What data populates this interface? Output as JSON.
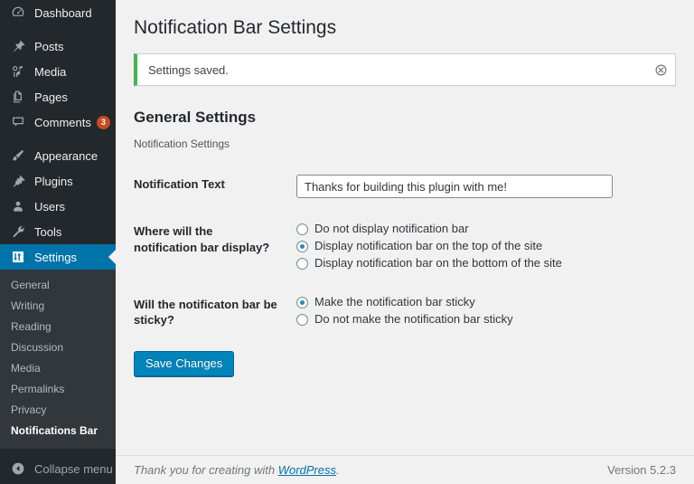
{
  "sidebar": {
    "items": [
      {
        "label": "Dashboard",
        "icon": "dashboard-icon",
        "current": false,
        "badge": null
      },
      {
        "label": "Posts",
        "icon": "pin-icon",
        "current": false,
        "badge": null
      },
      {
        "label": "Media",
        "icon": "media-icon",
        "current": false,
        "badge": null
      },
      {
        "label": "Pages",
        "icon": "pages-icon",
        "current": false,
        "badge": null
      },
      {
        "label": "Comments",
        "icon": "comment-icon",
        "current": false,
        "badge": "3"
      },
      {
        "label": "Appearance",
        "icon": "paintbrush-icon",
        "current": false,
        "badge": null
      },
      {
        "label": "Plugins",
        "icon": "plug-icon",
        "current": false,
        "badge": null
      },
      {
        "label": "Users",
        "icon": "user-icon",
        "current": false,
        "badge": null
      },
      {
        "label": "Tools",
        "icon": "wrench-icon",
        "current": false,
        "badge": null
      },
      {
        "label": "Settings",
        "icon": "sliders-icon",
        "current": true,
        "badge": null
      }
    ],
    "submenu": [
      {
        "label": "General",
        "current": false
      },
      {
        "label": "Writing",
        "current": false
      },
      {
        "label": "Reading",
        "current": false
      },
      {
        "label": "Discussion",
        "current": false
      },
      {
        "label": "Media",
        "current": false
      },
      {
        "label": "Permalinks",
        "current": false
      },
      {
        "label": "Privacy",
        "current": false
      },
      {
        "label": "Notifications Bar",
        "current": true
      }
    ],
    "collapse_label": "Collapse menu",
    "collapse_icon": "chevron-left-circle-icon",
    "colors": {
      "background": "#23282d",
      "submenu_background": "#32373c",
      "current_background": "#0073aa",
      "badge_background": "#ca4a1f"
    }
  },
  "page": {
    "title": "Notification Bar Settings"
  },
  "notice": {
    "message": "Settings saved.",
    "dismiss_icon": "dismiss-circle-icon",
    "accent_color": "#46b450"
  },
  "section": {
    "heading": "General Settings",
    "description": "Notification Settings"
  },
  "fields": {
    "notification_text": {
      "label": "Notification Text",
      "value": "Thanks for building this plugin with me!",
      "placeholder": ""
    },
    "display_position": {
      "label": "Where will the notification bar display?",
      "options": [
        {
          "label": "Do not display notification bar",
          "checked": false
        },
        {
          "label": "Display notification bar on the top of the site",
          "checked": true
        },
        {
          "label": "Display notification bar on the bottom of the site",
          "checked": false
        }
      ]
    },
    "sticky": {
      "label": "Will the notificaton bar be sticky?",
      "options": [
        {
          "label": "Make the notification bar sticky",
          "checked": true
        },
        {
          "label": "Do not make the notification bar sticky",
          "checked": false
        }
      ]
    }
  },
  "submit": {
    "save_label": "Save Changes",
    "button_color": "#0085ba"
  },
  "footer": {
    "thanks_prefix": "Thank you for creating with ",
    "link_label": "WordPress",
    "thanks_suffix": ".",
    "version": "Version 5.2.3"
  }
}
